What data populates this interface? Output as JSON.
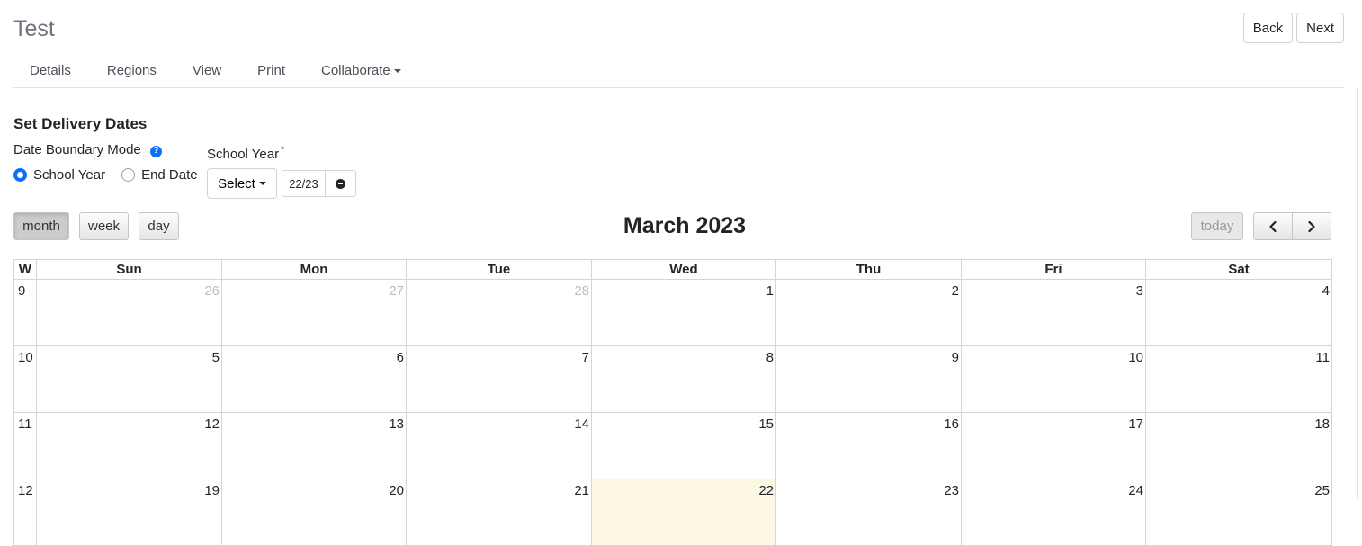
{
  "page": {
    "title": "Test"
  },
  "header_buttons": {
    "back": "Back",
    "next": "Next"
  },
  "nav": {
    "tabs": [
      "Details",
      "Regions",
      "View",
      "Print",
      "Collaborate"
    ]
  },
  "section": {
    "title": "Set Delivery Dates"
  },
  "date_boundary": {
    "label": "Date Boundary Mode",
    "help_icon": "question-circle-icon",
    "options": [
      "School Year",
      "End Date"
    ],
    "selected": "School Year"
  },
  "school_year": {
    "label": "School Year",
    "required_mark": "*",
    "select_label": "Select",
    "value": "22/23",
    "clear_icon": "minus-circle-icon"
  },
  "calendar": {
    "view_buttons": [
      "month",
      "week",
      "day"
    ],
    "active_view": "month",
    "title": "March 2023",
    "today_label": "today",
    "prev_icon": "chevron-left-icon",
    "next_icon": "chevron-right-icon",
    "week_header": "W",
    "day_headers": [
      "Sun",
      "Mon",
      "Tue",
      "Wed",
      "Thu",
      "Fri",
      "Sat"
    ],
    "weeks": [
      {
        "week": "9",
        "days": [
          "26",
          "27",
          "28",
          "1",
          "2",
          "3",
          "4"
        ]
      },
      {
        "week": "10",
        "days": [
          "5",
          "6",
          "7",
          "8",
          "9",
          "10",
          "11"
        ]
      },
      {
        "week": "11",
        "days": [
          "12",
          "13",
          "14",
          "15",
          "16",
          "17",
          "18"
        ]
      },
      {
        "week": "12",
        "days": [
          "19",
          "20",
          "21",
          "22",
          "23",
          "24",
          "25"
        ]
      }
    ],
    "other_month_days": [
      "26",
      "27",
      "28"
    ],
    "today": "22",
    "today_color": "#fcf8e3"
  }
}
